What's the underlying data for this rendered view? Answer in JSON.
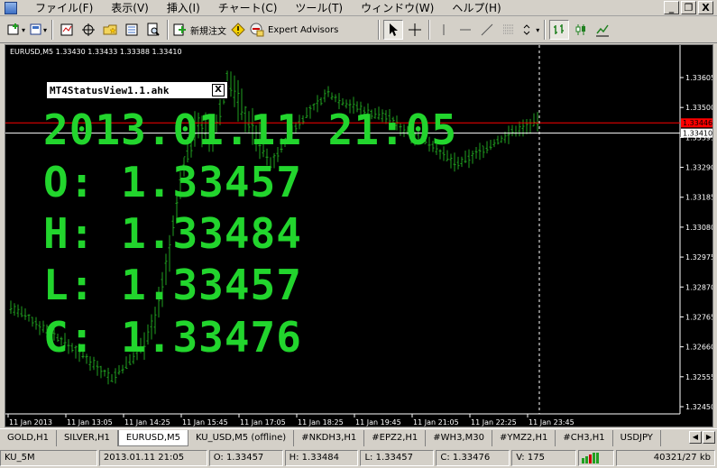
{
  "menu": {
    "items": [
      "ファイル(F)",
      "表示(V)",
      "挿入(I)",
      "チャート(C)",
      "ツール(T)",
      "ウィンドウ(W)",
      "ヘルプ(H)"
    ],
    "window_controls": [
      "_",
      "❐",
      "X"
    ]
  },
  "toolbar": {
    "new_order_label": "新規注文",
    "expert_advisors_label": "Expert Advisors"
  },
  "chart": {
    "header": "EURUSD,M5  1.33430 1.33433 1.33388 1.33410",
    "background": "#000000",
    "candle_color": "#20a020",
    "ask_line_color": "#ff0000",
    "bid_line_color": "#ffffff",
    "ask_price": "1.33446",
    "bid_price": "1.33410",
    "price_labels": [
      "1.33605",
      "1.33500",
      "1.33395",
      "1.33290",
      "1.33185",
      "1.33080",
      "1.32975",
      "1.32870",
      "1.32765",
      "1.32660",
      "1.32555",
      "1.32450"
    ],
    "time_labels": [
      "11 Jan 2013",
      "11 Jan 13:05",
      "11 Jan 14:25",
      "11 Jan 15:45",
      "11 Jan 17:05",
      "11 Jan 18:25",
      "11 Jan 19:45",
      "11 Jan 21:05",
      "11 Jan 22:25",
      "11 Jan 23:45"
    ]
  },
  "overlay": {
    "title": "MT4StatusView1.1.ahk",
    "close": "X",
    "datetime": "2013.01.11 21:05",
    "open": "O: 1.33457",
    "high": "H: 1.33484",
    "low": "L: 1.33457",
    "close_value": "C: 1.33476",
    "text_color": "#22d52d"
  },
  "tabs": [
    {
      "label": "GOLD,H1",
      "active": false
    },
    {
      "label": "SILVER,H1",
      "active": false
    },
    {
      "label": "EURUSD,M5",
      "active": true
    },
    {
      "label": "KU_USD,M5 (offline)",
      "active": false
    },
    {
      "label": "#NKDH3,H1",
      "active": false
    },
    {
      "label": "#EPZ2,H1",
      "active": false
    },
    {
      "label": "#WH3,M30",
      "active": false
    },
    {
      "label": "#YMZ2,H1",
      "active": false
    },
    {
      "label": "#CH3,H1",
      "active": false
    },
    {
      "label": "USDJPY",
      "active": false
    }
  ],
  "tab_arrows": [
    "◀",
    "▶"
  ],
  "statusbar": {
    "profile": "KU_5M",
    "datetime": "2013.01.11 21:05",
    "open": "O: 1.33457",
    "high": "H: 1.33484",
    "low": "L: 1.33457",
    "close": "C: 1.33476",
    "volume": "V: 175",
    "traffic": "40321/27 kb"
  }
}
